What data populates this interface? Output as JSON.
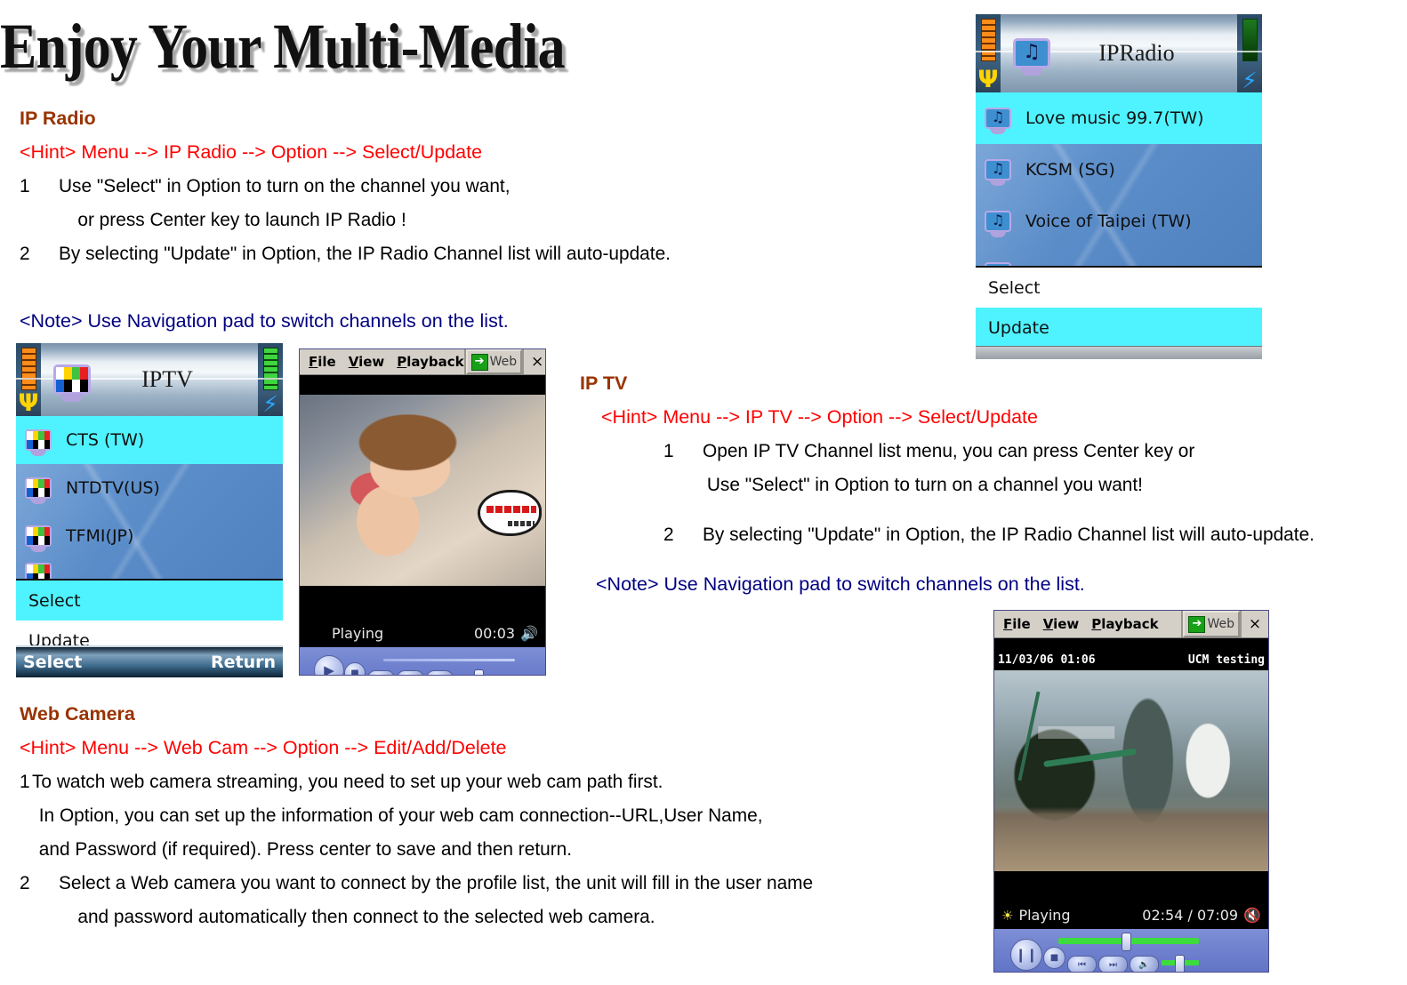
{
  "banner": {
    "title": "Enjoy Your Multi-Media"
  },
  "sections": {
    "ip_radio": {
      "heading": "IP Radio",
      "hint": "<Hint> Menu --> IP Radio --> Option --> Select/Update",
      "steps": [
        {
          "num": "1",
          "lines": [
            "Use \"Select\" in Option to turn on the channel you want,",
            "or press Center key to launch IP Radio !"
          ]
        },
        {
          "num": "2",
          "lines": [
            "By selecting \"Update\" in Option, the IP Radio Channel list will auto-update."
          ]
        }
      ],
      "note": "<Note> Use Navigation pad to switch channels on the list."
    },
    "ip_tv": {
      "heading": "IP TV",
      "hint": "<Hint> Menu --> IP TV --> Option --> Select/Update",
      "steps": [
        {
          "num": "1",
          "lines": [
            "Open IP TV Channel list menu, you can press Center key or",
            "Use \"Select\" in Option to turn on a channel you want!"
          ]
        },
        {
          "num": "2",
          "lines": [
            "By selecting \"Update\" in Option, the IP Radio Channel list will auto-update."
          ]
        }
      ],
      "note": "<Note> Use Navigation pad to switch channels on the list."
    },
    "web_camera": {
      "heading": "Web Camera",
      "hint": "<Hint> Menu --> Web Cam --> Option --> Edit/Add/Delete",
      "steps": [
        {
          "num": "1",
          "lines": [
            "To watch web camera streaming, you need to set up your web cam path first.",
            "In Option, you can set up the information of your web cam connection--URL,User Name,",
            "and Password (if required). Press center to save and then return."
          ]
        },
        {
          "num": "2",
          "lines": [
            "Select a Web camera you want to connect by the profile list, the unit will fill in the user name",
            "and password automatically then connect to the selected web camera."
          ]
        }
      ]
    }
  },
  "devices": {
    "ipradio": {
      "title": "IPRadio",
      "icon": "monitor-music-icon",
      "channels": [
        {
          "label": "Love music 99.7(TW)",
          "selected": true
        },
        {
          "label": "KCSM (SG)",
          "selected": false
        },
        {
          "label": "Voice of Taipei (TW)",
          "selected": false
        }
      ],
      "menu": [
        {
          "label": "Select",
          "selected": false
        },
        {
          "label": "Update",
          "selected": true
        }
      ]
    },
    "iptv": {
      "title": "IPTV",
      "icon": "monitor-testpattern-icon",
      "channels": [
        {
          "label": "CTS (TW)",
          "selected": true
        },
        {
          "label": "NTDTV(US)",
          "selected": false
        },
        {
          "label": "TFMI(JP)",
          "selected": false
        }
      ],
      "menu": [
        {
          "label": "Select",
          "selected": true
        },
        {
          "label": "Update",
          "selected": false
        }
      ],
      "softkeys": {
        "left": "Select",
        "right": "Return"
      }
    }
  },
  "players": {
    "iptv_player": {
      "menus": [
        "File",
        "View",
        "Playback"
      ],
      "web_button": "Web",
      "close_button": "×",
      "status": "Playing",
      "time": "00:03",
      "volume_icon": "speaker-on-icon"
    },
    "webcam_player": {
      "menus": [
        "File",
        "View",
        "Playback"
      ],
      "web_button": "Web",
      "close_button": "×",
      "osd_left": "11/03/06 01:06",
      "osd_right": "UCM testing",
      "status": "Playing",
      "time": "02:54 / 07:09",
      "volume_icon": "speaker-mute-icon",
      "status_icon": "sun-icon"
    }
  },
  "colors": {
    "heading": "#993300",
    "hint": "#ff0000",
    "note": "#000080",
    "selection": "#4ff3ff"
  }
}
